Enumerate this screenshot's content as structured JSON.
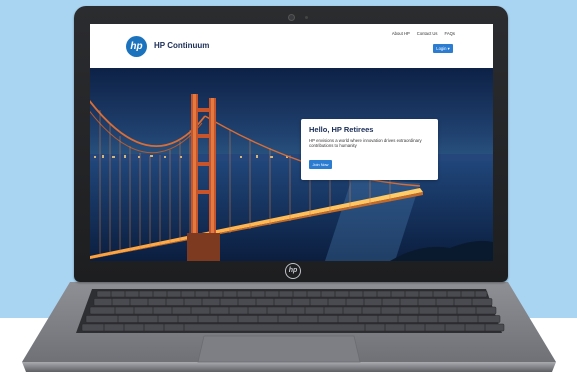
{
  "website": {
    "brand": {
      "logo_text": "hp",
      "name": "HP Continuum"
    },
    "nav": {
      "items": [
        "About HP",
        "Contact Us",
        "FAQs"
      ]
    },
    "login_button": "Login ▾",
    "hero": {
      "title": "Hello, HP Retirees",
      "subtitle": "HP envisions a world where innovation drives extraordinary contributions to humanity",
      "cta": "Join Now"
    }
  },
  "device": {
    "bezel_logo": "hp",
    "colors": {
      "background": "#a9d5f2",
      "accent": "#2c7dd2",
      "brand": "#1c73bd"
    }
  }
}
